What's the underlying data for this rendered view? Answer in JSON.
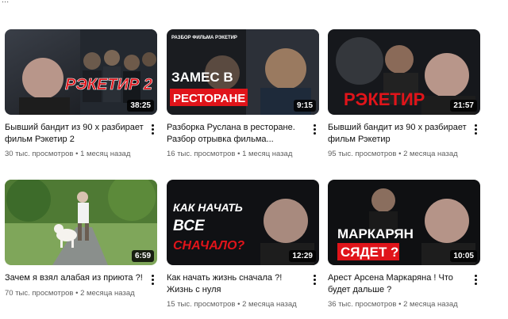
{
  "top_fragment": "...",
  "videos": [
    {
      "title": "Бывший бандит из 90 х разбирает фильм Рэкетир 2",
      "views": "30 тыс. просмотров",
      "age": "1 месяц назад",
      "duration": "38:25",
      "thumb_text": "РЭКЕТИР 2",
      "thumb_small": ""
    },
    {
      "title": "Разборка Руслана в ресторане. Разбор отрывка фильма...",
      "views": "16 тыс. просмотров",
      "age": "1 месяц назад",
      "duration": "9:15",
      "thumb_text": "ЗАМЕС В",
      "thumb_text2": "РЕСТОРАНЕ",
      "thumb_small": "РАЗБОР ФИЛЬМА РЭКЕТИР"
    },
    {
      "title": "Бывший бандит из 90 х разбирает фильм Рэкетир",
      "views": "95 тыс. просмотров",
      "age": "2 месяца назад",
      "duration": "21:57",
      "thumb_text": "РЭКЕТИР"
    },
    {
      "title": "Зачем я взял алабая из приюта ?!",
      "views": "70 тыс. просмотров",
      "age": "2 месяца назад",
      "duration": "6:59"
    },
    {
      "title": "Как начать жизнь сначала ?! Жизнь с нуля",
      "views": "15 тыс. просмотров",
      "age": "2 месяца назад",
      "duration": "12:29",
      "thumb_text": "КАК НАЧАТЬ",
      "thumb_text2": "ВСЕ",
      "thumb_text3": "СНАЧАЛО?"
    },
    {
      "title": "Арест Арсена Маркаряна ! Что будет дальше ?",
      "views": "36 тыс. просмотров",
      "age": "2 месяца назад",
      "duration": "10:05",
      "thumb_text": "МАРКАРЯН",
      "thumb_text2": "СЯДЕТ ?"
    }
  ],
  "separator": "•",
  "colors": {
    "title": "#0f0f0f",
    "meta": "#606060",
    "accent_red": "#e0141a"
  }
}
